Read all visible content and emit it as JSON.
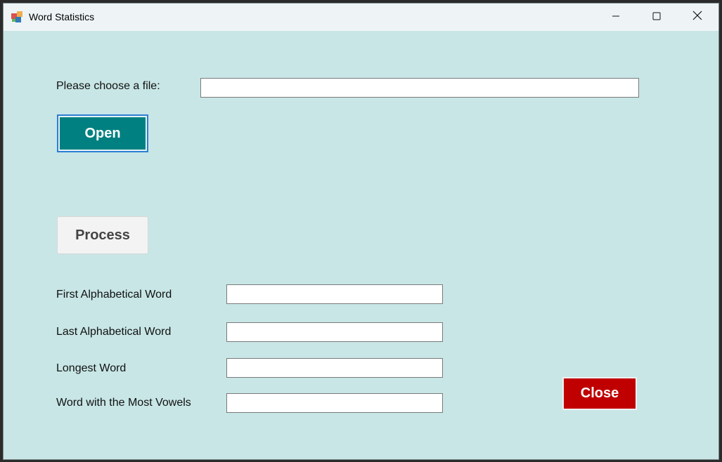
{
  "window": {
    "title": "Word Statistics"
  },
  "file_section": {
    "choose_label": "Please choose a file:",
    "file_path_value": "",
    "open_label": "Open"
  },
  "process_label": "Process",
  "results": {
    "first_label": "First Alphabetical Word",
    "first_value": "",
    "last_label": "Last Alphabetical Word",
    "last_value": "",
    "longest_label": "Longest Word",
    "longest_value": "",
    "vowels_label": "Word with the Most Vowels",
    "vowels_value": ""
  },
  "close_label": "Close",
  "colors": {
    "window_bg": "#c8e6e6",
    "open_bg": "#008080",
    "close_bg": "#c00000",
    "process_bg": "#f3f3f3"
  },
  "icons": {
    "app": "app-icon",
    "minimize": "minimize-icon",
    "maximize": "maximize-icon",
    "close": "close-icon"
  }
}
